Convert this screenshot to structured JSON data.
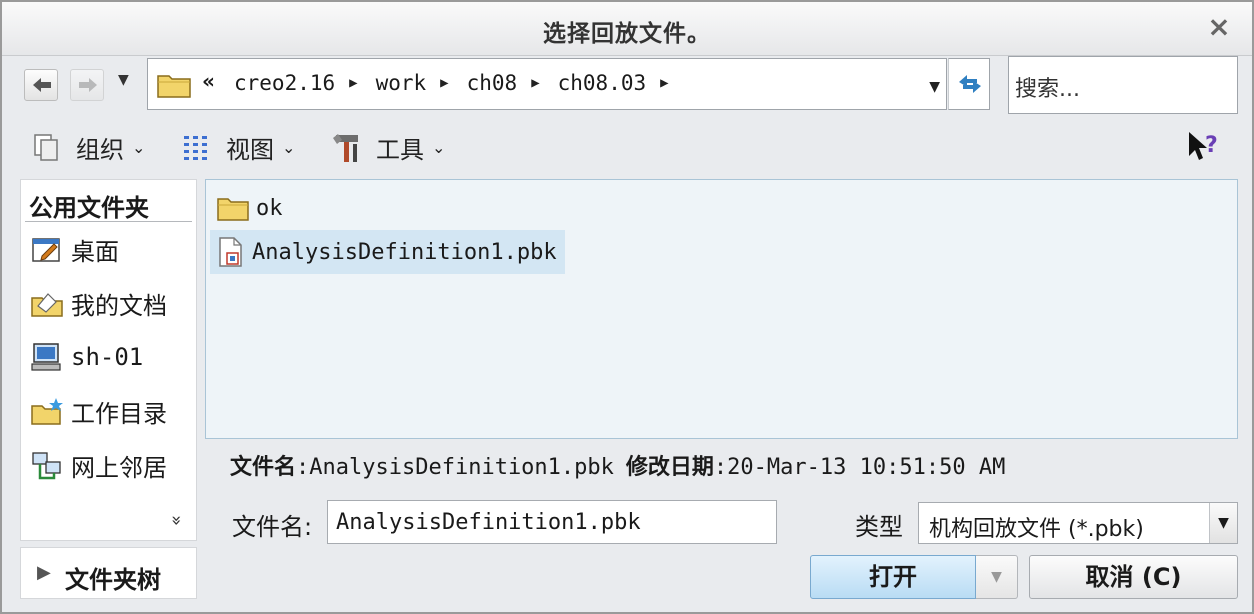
{
  "window": {
    "title": "选择回放文件。",
    "close_symbol": "×"
  },
  "navigation": {
    "back_icon": "back-arrow-icon",
    "forward_icon": "forward-arrow-icon",
    "history_symbol": "▼",
    "breadcrumb_prefix": "«",
    "breadcrumbs": [
      "creo2.16",
      "work",
      "ch08",
      "ch08.03"
    ],
    "crumb_separator": "▶",
    "dropdown_symbol": "▼",
    "search_placeholder": "搜索..."
  },
  "toolbar": {
    "organize_label": "组织",
    "view_label": "视图",
    "tools_label": "工具",
    "chevron": "⌄"
  },
  "sidebar": {
    "title": "公用文件夹",
    "items": [
      {
        "label": "桌面",
        "icon": "desktop-icon"
      },
      {
        "label": "我的文档",
        "icon": "my-documents-icon"
      },
      {
        "label": "sh-01",
        "icon": "computer-icon"
      },
      {
        "label": "工作目录",
        "icon": "working-directory-icon"
      },
      {
        "label": "网上邻居",
        "icon": "network-icon"
      }
    ],
    "more_symbol": "»",
    "folder_tree_label": "文件夹树",
    "folder_tree_arrow": "▶"
  },
  "files": [
    {
      "name": "ok",
      "type": "folder",
      "selected": false
    },
    {
      "name": "AnalysisDefinition1.pbk",
      "type": "file",
      "selected": true
    }
  ],
  "info": {
    "filename_label": "文件名",
    "filename_value": ":AnalysisDefinition1.pbk",
    "modified_label": "修改日期",
    "modified_value": ":20-Mar-13 10:51:50 AM"
  },
  "filename_field": {
    "label": "文件名:",
    "value": "AnalysisDefinition1.pbk"
  },
  "type_field": {
    "label": "类型",
    "value": "机构回放文件 (*.pbk)",
    "dropdown_symbol": "▼"
  },
  "buttons": {
    "open": "打开",
    "open_dropdown": "▼",
    "cancel": "取消 (C)"
  },
  "colors": {
    "selection": "#d3e6f3",
    "list_background": "#eef4f8",
    "open_button": "#c7e4f7"
  }
}
